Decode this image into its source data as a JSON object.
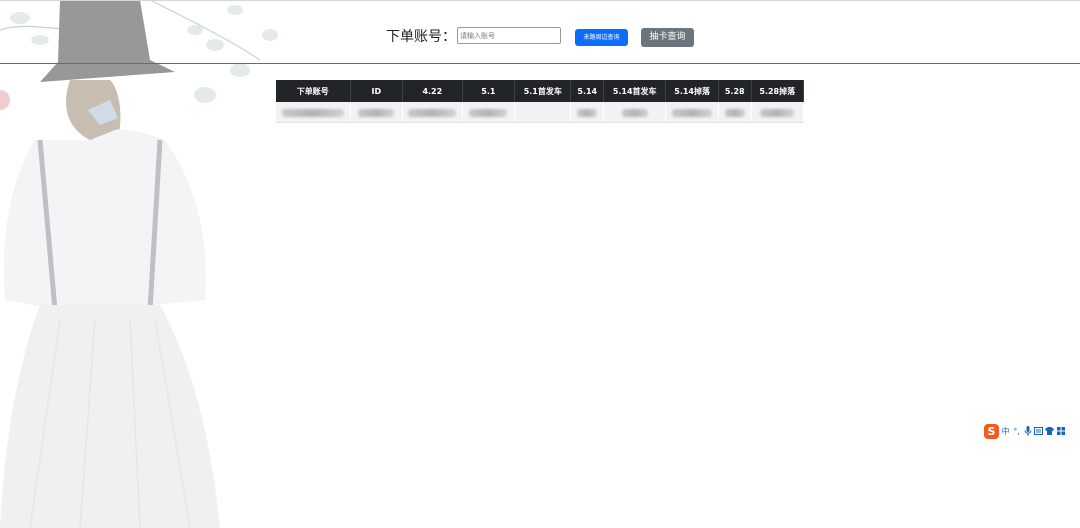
{
  "search": {
    "label": "下单账号：",
    "placeholder": "请输入账号",
    "primary_button": "来路周边查询",
    "secondary_button": "抽卡查询"
  },
  "table": {
    "columns": [
      "下单账号",
      "ID",
      "4.22",
      "5.1",
      "5.1首发车",
      "5.14",
      "5.14首发车",
      "5.14掉落",
      "5.28",
      "5.28掉落"
    ]
  },
  "ime_toolbar": {
    "logo": "S",
    "items": [
      "中",
      "°,",
      "mic-icon",
      "keyboard-icon",
      "shirt-icon",
      "grid-icon"
    ]
  },
  "colors": {
    "primary": "#0d6efd",
    "secondary": "#6c757d",
    "table_header": "#212529",
    "ime_logo": "#f25c1f"
  }
}
